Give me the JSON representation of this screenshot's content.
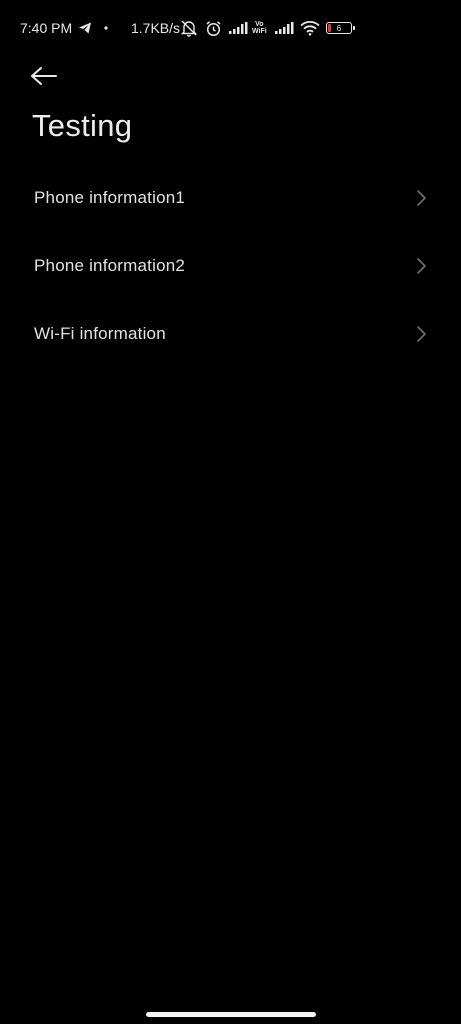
{
  "status_bar": {
    "time": "7:40 PM",
    "network_speed": "1.7KB/s",
    "vowifi_top": "Vo",
    "vowifi_bottom": "WiFi",
    "battery_level": "6",
    "icons": [
      "telegram-icon",
      "muted-notification-icon",
      "alarm-icon",
      "signal-icon",
      "vowifi-icon",
      "signal-icon",
      "wifi-icon",
      "battery-icon"
    ],
    "battery_color": "#e23a3a"
  },
  "header": {
    "title": "Testing"
  },
  "menu": {
    "items": [
      {
        "label": "Phone information1"
      },
      {
        "label": "Phone information2"
      },
      {
        "label": "Wi-Fi information"
      }
    ]
  },
  "colors": {
    "background": "#000000",
    "text": "#e2e2e2",
    "chevron": "#6e6e6e"
  }
}
